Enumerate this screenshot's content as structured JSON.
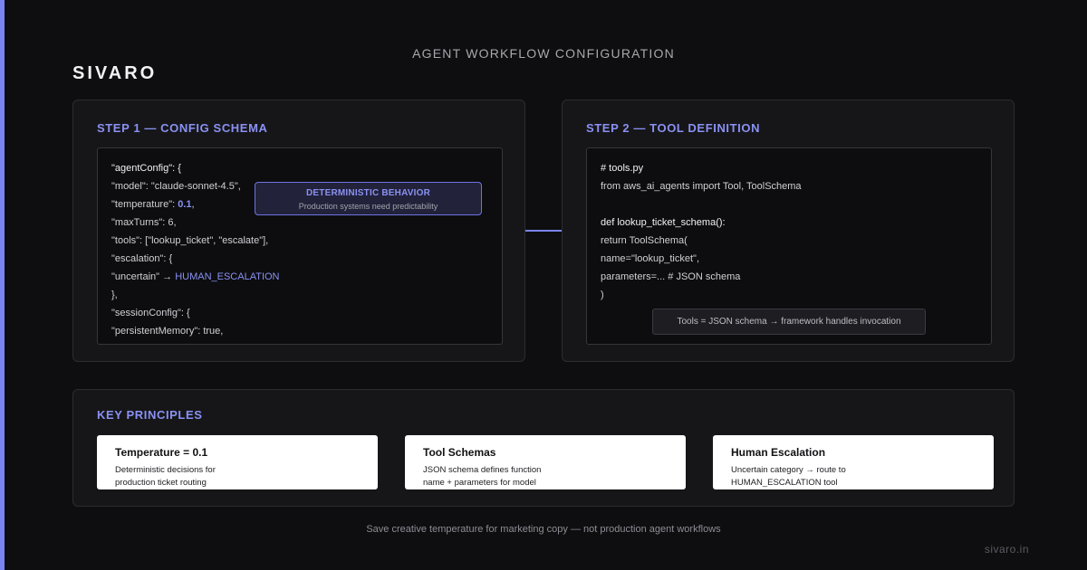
{
  "page": {
    "heading": "AGENT WORKFLOW CONFIGURATION",
    "brand": "SIVARO",
    "site": "sivaro.in",
    "footer": "Save creative temperature for marketing copy — not production agent workflows",
    "accent_color": "#7b84f0"
  },
  "step1": {
    "title": "STEP 1 — CONFIG SCHEMA",
    "lines": {
      "l0": "\"agentConfig\": {",
      "l1": "\"model\": \"claude-sonnet-4.5\",",
      "l2_pre": "\"temperature\": ",
      "l2_val": "0.1",
      "l2_post": ",",
      "l3": "\"maxTurns\": 6,",
      "l4": "\"tools\": [\"lookup_ticket\", \"escalate\"],",
      "l5": "\"escalation\": {",
      "l6_pre": "\"uncertain\" → ",
      "l6_val": "HUMAN_ESCALATION",
      "l7": "},",
      "l8": "\"sessionConfig\": {",
      "l9": "\"persistentMemory\": true,"
    },
    "callout": {
      "title": "DETERMINISTIC BEHAVIOR",
      "subtitle": "Production systems need predictability"
    }
  },
  "step2": {
    "title": "STEP 2 — TOOL DEFINITION",
    "lines": {
      "l0": "# tools.py",
      "l1": "from aws_ai_agents import Tool, ToolSchema",
      "l2": "def lookup_ticket_schema():",
      "l3": "return ToolSchema(",
      "l4": "name=\"lookup_ticket\",",
      "l5": "parameters=... # JSON schema",
      "l6": ")"
    },
    "note": "Tools = JSON schema → framework handles invocation"
  },
  "principles": {
    "title": "KEY PRINCIPLES",
    "cards": [
      {
        "title": "Temperature = 0.1",
        "line1": "Deterministic decisions for",
        "line2": "production ticket routing"
      },
      {
        "title": "Tool Schemas",
        "line1": "JSON schema defines function",
        "line2": "name + parameters for model"
      },
      {
        "title": "Human Escalation",
        "line1": "Uncertain category → route to",
        "line2": "HUMAN_ESCALATION tool"
      }
    ]
  }
}
